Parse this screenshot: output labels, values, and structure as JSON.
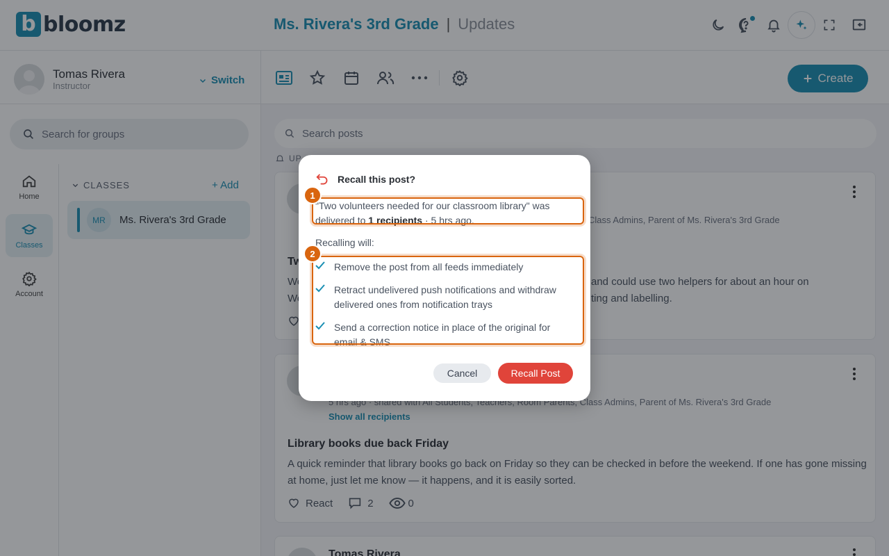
{
  "header": {
    "logo_mark": "b",
    "logo_text": "bloomz",
    "class_name": "Ms. Rivera's 3rd Grade",
    "separator": "|",
    "page": "Updates",
    "icons": [
      "moon-icon",
      "help-chat-icon",
      "bell-icon",
      "ai-sparkle-icon",
      "fullscreen-icon",
      "collapse-panel-icon"
    ]
  },
  "sidebar": {
    "user_name": "Tomas Rivera",
    "user_role": "Instructor",
    "switch_label": "Switch",
    "search_placeholder": "Search for groups",
    "rail": [
      {
        "label": "Home",
        "icon": "home-icon"
      },
      {
        "label": "Classes",
        "icon": "graduation-cap-icon",
        "active": true
      },
      {
        "label": "Account",
        "icon": "gear-icon"
      }
    ],
    "classes_header": "CLASSES",
    "add_label": "Add",
    "class_item": {
      "initials": "MR",
      "name": "Ms. Rivera's 3rd Grade"
    }
  },
  "toolbar": {
    "icons": [
      "posts-icon",
      "star-icon",
      "calendar-icon",
      "people-icon",
      "more-icon",
      "settings-icon"
    ],
    "create_label": "Create"
  },
  "feed": {
    "search_placeholder": "Search posts",
    "section_label": "UP",
    "posts": [
      {
        "meta_tail": "Class Admins, Parent of Ms. Rivera's 3rd Grade",
        "title_start": "Tw",
        "body_left1": "We",
        "body_right1": "and could use two helpers for about an hour on",
        "body_left2": "We",
        "body_right2": "ting and labelling."
      },
      {
        "meta": "5 hrs ago · shared with All Students, Teachers, Room Parents, Class Admins, Parent of Ms. Rivera's 3rd Grade",
        "show_all": "Show all recipients",
        "title": "Library books due back Friday",
        "body": "A quick reminder that library books go back on Friday so they can be checked in before the weekend. If one has gone missing at home, just let me know — it happens, and it is easily sorted.",
        "react_label": "React",
        "comments": "2",
        "views": "0"
      },
      {
        "author": "Tomas Rivera"
      }
    ]
  },
  "dialog": {
    "title": "Recall this post?",
    "line_pre": "\"Two volunteers needed for our classroom library\" was delivered to ",
    "recipients": "1 recipients",
    "line_post": " · 5 hrs ago.",
    "sub": "Recalling will:",
    "items": [
      "Remove the post from all feeds immediately",
      "Retract undelivered push notifications and withdraw delivered ones from notification trays",
      "Send a correction notice in place of the original for email & SMS"
    ],
    "cancel_label": "Cancel",
    "recall_label": "Recall Post",
    "badges": [
      "1",
      "2"
    ]
  }
}
